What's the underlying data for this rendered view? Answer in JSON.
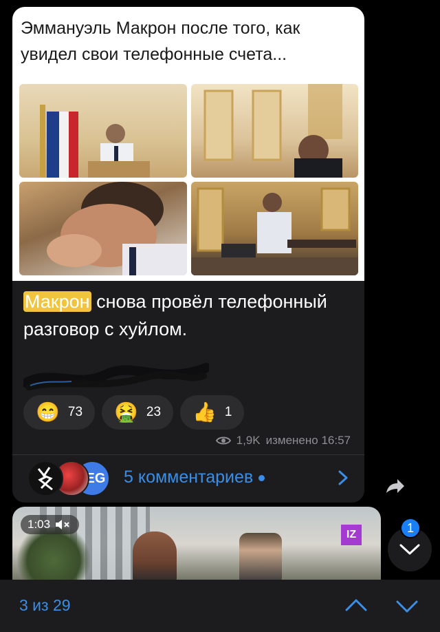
{
  "post": {
    "meme_caption": "Эммануэль Макрон после того, как увидел свои телефонные счета...",
    "text_highlight": "Макрон",
    "text_rest": " снова провёл телефонный разговор с хуйлом.",
    "reactions": [
      {
        "emoji": "😁",
        "count": "73"
      },
      {
        "emoji": "🤮",
        "count": "23"
      },
      {
        "emoji": "👍",
        "count": "1"
      }
    ],
    "views": "1,9K",
    "edited_time": "изменено 16:57",
    "comments_label": "5 комментариев",
    "avatar_initials": "EG"
  },
  "video": {
    "duration": "1:03",
    "channel_logo": "IZ"
  },
  "scroll": {
    "unread_badge": "1"
  },
  "bottom_bar": {
    "counter": "3 из 29"
  },
  "colors": {
    "accent": "#3a8ee6",
    "highlight": "#f0c43c",
    "bubble": "#1c1c1e"
  }
}
